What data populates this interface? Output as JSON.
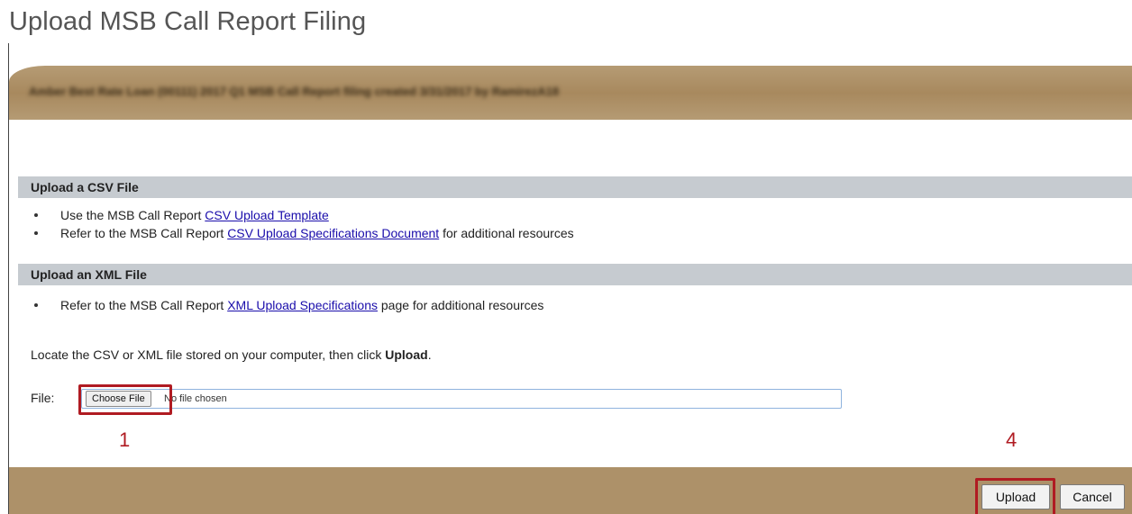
{
  "page": {
    "title": "Upload MSB Call Report Filing"
  },
  "banner": {
    "text": "Amber Best Rate Loan (00111) 2017 Q1 MSB Call Report filing created 3/31/2017 by RamirezA18"
  },
  "csv_section": {
    "header": "Upload a CSV File",
    "bullets": [
      {
        "prefix": "Use the MSB Call Report ",
        "link": "CSV Upload Template",
        "suffix": ""
      },
      {
        "prefix": "Refer to the MSB Call Report ",
        "link": "CSV Upload Specifications Document",
        "suffix": " for additional resources"
      }
    ]
  },
  "xml_section": {
    "header": "Upload an XML File",
    "bullets": [
      {
        "prefix": "Refer to the MSB Call Report ",
        "link": "XML Upload Specifications",
        "suffix": " page for additional resources"
      }
    ]
  },
  "instruction": {
    "prefix": "Locate the CSV or XML file stored on your computer, then click ",
    "bold": "Upload",
    "suffix": "."
  },
  "file_field": {
    "label": "File:",
    "button_label": "Choose File",
    "status": "No file chosen"
  },
  "callouts": {
    "step1": "1",
    "step4": "4"
  },
  "actions": {
    "upload_label": "Upload",
    "cancel_label": "Cancel"
  },
  "colors": {
    "banner": "#a8895e",
    "footer": "#ad9169",
    "section_header": "#c6cbd0",
    "highlight": "#b01b22",
    "link": "#1a0dab"
  }
}
